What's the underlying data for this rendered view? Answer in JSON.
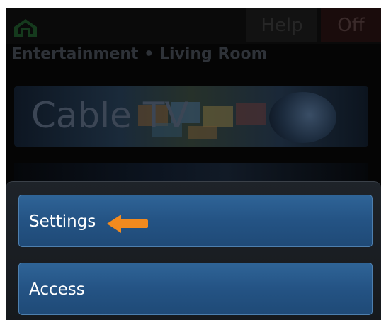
{
  "topbar": {
    "home_icon": "home-icon",
    "help_label": "Help",
    "off_label": "Off"
  },
  "breadcrumb": {
    "category": "Entertainment",
    "separator": "•",
    "room": "Living Room",
    "text": "Entertainment • Living Room"
  },
  "banner": {
    "title": "Cable TV"
  },
  "menu": {
    "items": [
      {
        "label": "Settings"
      },
      {
        "label": "Access"
      }
    ]
  },
  "annotation": {
    "arrow_color": "#f28a1e",
    "arrow_icon": "arrow-left-icon"
  },
  "colors": {
    "button_blue": "#245384",
    "background": "#050505",
    "accent_orange": "#f28a1e"
  }
}
